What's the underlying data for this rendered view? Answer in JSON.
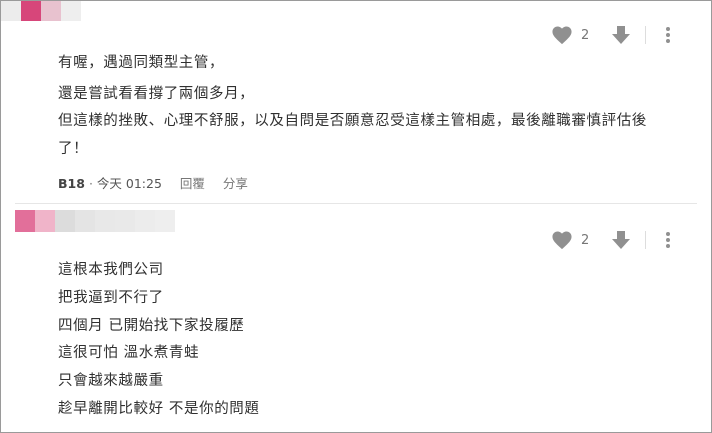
{
  "comments": [
    {
      "author": "B18",
      "time": "今天 01:25",
      "reply_label": "回覆",
      "share_label": "分享",
      "likes": "2",
      "lines": [
        "有喔，遇過同類型主管，",
        "還是嘗試看看撐了兩個多月，",
        "但這樣的挫敗、心理不舒服，以及自問是否願意忍受這樣主管相處，最後離職審慎評估後",
        "了！"
      ],
      "mosaic": [
        "#ececec",
        "#d7467a",
        "#e8c2cf",
        "#eeeeee"
      ]
    },
    {
      "likes": "2",
      "lines": [
        "這根本我們公司",
        "把我逼到不行了",
        "四個月 已開始找下家投履歷",
        "這很可怕 溫水煮青蛙",
        "只會越來越嚴重",
        "趁早離開比較好 不是你的問題"
      ],
      "mosaic": [
        "#e26f9a",
        "#f0b4c9",
        "#dcdcdc",
        "#e4e4e4",
        "#e8e8e8",
        "#e9e9e9",
        "#ececec",
        "#eeeeee"
      ]
    }
  ],
  "colors": {
    "icon": "#909090",
    "text": "#303030"
  }
}
